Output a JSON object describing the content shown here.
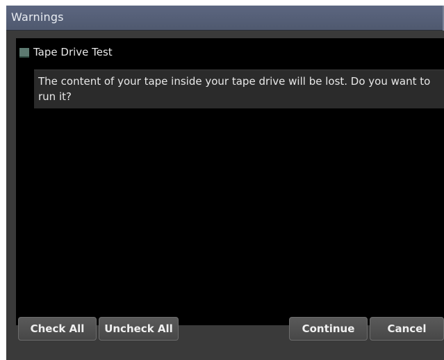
{
  "window": {
    "title": "Warnings"
  },
  "warnings": [
    {
      "label": "Tape Drive Test",
      "checked": false,
      "message": "The content of your tape inside your tape drive will be lost. Do you want to run it?"
    }
  ],
  "buttons": {
    "check_all": "Check All",
    "uncheck_all": "Uncheck All",
    "continue": "Continue",
    "cancel": "Cancel"
  },
  "colors": {
    "titlebar": "#56607a",
    "content_bg": "#000000",
    "checkbox": "#5d7a71",
    "message_bg": "#2b2b2b"
  }
}
